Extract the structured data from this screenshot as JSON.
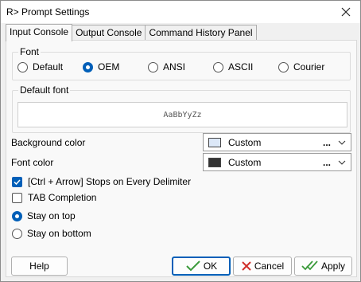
{
  "window": {
    "title": "R> Prompt Settings"
  },
  "tabs": [
    {
      "label": "Input Console",
      "active": true
    },
    {
      "label": "Output Console",
      "active": false
    },
    {
      "label": "Command History Panel",
      "active": false
    }
  ],
  "font_group": {
    "label": "Font",
    "options": [
      {
        "label": "Default",
        "selected": false
      },
      {
        "label": "OEM",
        "selected": true
      },
      {
        "label": "ANSI",
        "selected": false
      },
      {
        "label": "ASCII",
        "selected": false
      },
      {
        "label": "Courier",
        "selected": false
      }
    ]
  },
  "default_font_group": {
    "label": "Default font",
    "preview_text": "AaBbYyZz"
  },
  "background_color": {
    "label": "Background color",
    "value": "Custom",
    "dots": "...",
    "swatch": "#dce8f8"
  },
  "font_color": {
    "label": "Font color",
    "value": "Custom",
    "dots": "...",
    "swatch": "#333333"
  },
  "checkboxes": [
    {
      "label": "[Ctrl + Arrow] Stops on Every Delimiter",
      "checked": true
    },
    {
      "label": "TAB Completion",
      "checked": false
    }
  ],
  "position_radios": [
    {
      "label": "Stay on top",
      "selected": true
    },
    {
      "label": "Stay on bottom",
      "selected": false
    }
  ],
  "buttons": {
    "help": "Help",
    "ok": "OK",
    "cancel": "Cancel",
    "apply": "Apply"
  },
  "colors": {
    "accent": "#005fb8",
    "ok_check": "#3a9a3a",
    "cancel_x": "#d0302b"
  }
}
